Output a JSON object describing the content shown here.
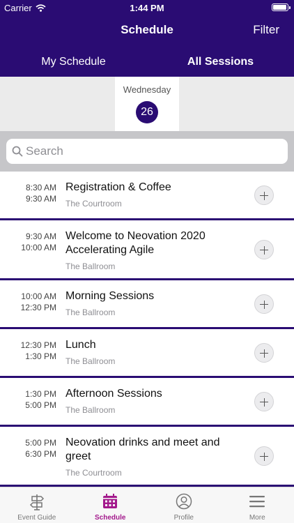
{
  "status_bar": {
    "carrier": "Carrier",
    "time": "1:44 PM"
  },
  "nav": {
    "title": "Schedule",
    "filter_label": "Filter"
  },
  "segments": [
    {
      "label": "My Schedule",
      "active": false
    },
    {
      "label": "All Sessions",
      "active": true
    }
  ],
  "date": {
    "weekday": "Wednesday",
    "day": "26"
  },
  "search": {
    "placeholder": "Search",
    "value": ""
  },
  "sessions": [
    {
      "start": "8:30 AM",
      "end": "9:30 AM",
      "title": "Registration & Coffee",
      "room": "The Courtroom"
    },
    {
      "start": "9:30 AM",
      "end": "10:00 AM",
      "title": "Welcome to Neovation 2020 Accelerating Agile",
      "room": "The Ballroom"
    },
    {
      "start": "10:00 AM",
      "end": "12:30 PM",
      "title": "Morning Sessions",
      "room": "The Ballroom"
    },
    {
      "start": "12:30 PM",
      "end": "1:30 PM",
      "title": "Lunch",
      "room": "The Ballroom"
    },
    {
      "start": "1:30 PM",
      "end": "5:00 PM",
      "title": "Afternoon Sessions",
      "room": "The Ballroom"
    },
    {
      "start": "5:00 PM",
      "end": "6:30 PM",
      "title": "Neovation drinks and meet and greet",
      "room": "The Courtroom"
    }
  ],
  "tab_bar": [
    {
      "label": "Event Guide",
      "icon": "signpost-icon",
      "active": false
    },
    {
      "label": "Schedule",
      "icon": "calendar-icon",
      "active": true
    },
    {
      "label": "Profile",
      "icon": "profile-icon",
      "active": false
    },
    {
      "label": "More",
      "icon": "menu-icon",
      "active": false
    }
  ],
  "colors": {
    "primary": "#2a0c73",
    "tab_active": "#a3198c"
  }
}
